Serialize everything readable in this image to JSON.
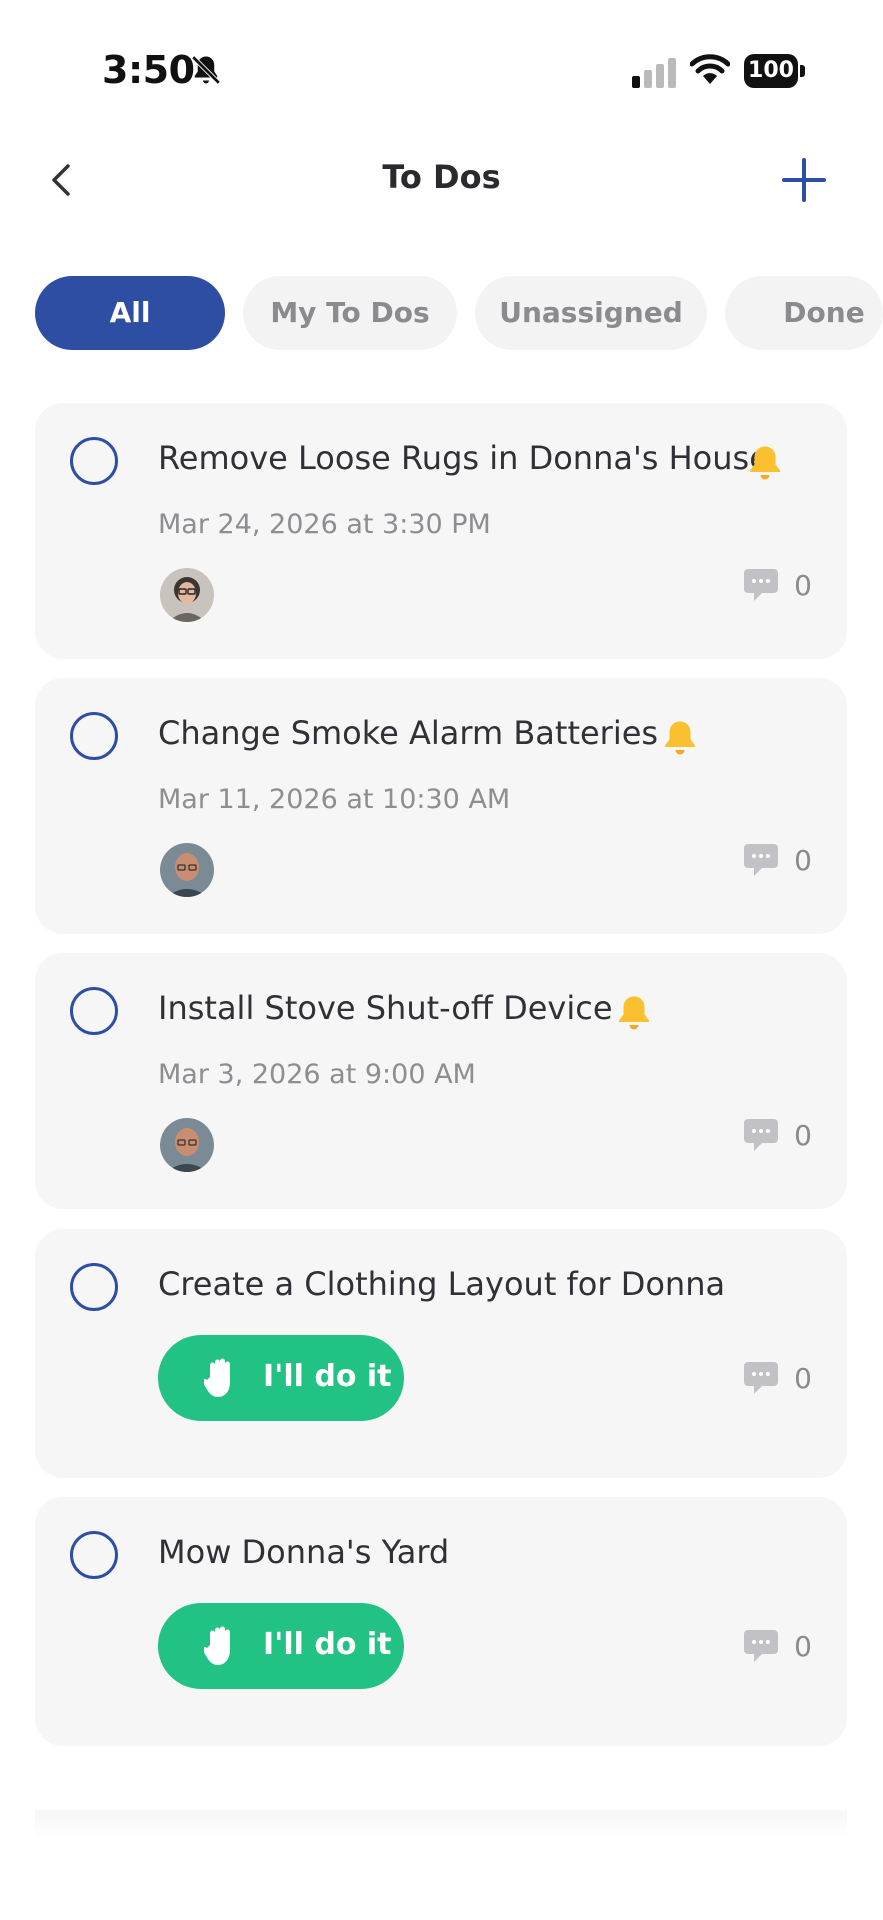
{
  "status_bar": {
    "time": "3:50",
    "battery": "100"
  },
  "header": {
    "title": "To Dos"
  },
  "tabs": [
    {
      "label": "All",
      "active": true
    },
    {
      "label": "My To Dos",
      "active": false
    },
    {
      "label": "Unassigned",
      "active": false
    },
    {
      "label": "Done",
      "active": false
    }
  ],
  "todos": [
    {
      "title": "Remove Loose Rugs in Donna's House",
      "date": "Mar 24, 2026 at 3:30 PM",
      "reminder": true,
      "assignee_icon": "woman-avatar",
      "comments": "0"
    },
    {
      "title": "Change Smoke Alarm Batteries",
      "date": "Mar 11, 2026 at 10:30 AM",
      "reminder": true,
      "assignee_icon": "man-avatar",
      "comments": "0"
    },
    {
      "title": "Install Stove Shut-off Device",
      "date": "Mar 3, 2026 at 9:00 AM",
      "reminder": true,
      "assignee_icon": "man-avatar",
      "comments": "0"
    },
    {
      "title": "Create a Clothing Layout for Donna",
      "action_label": "I'll do it",
      "comments": "0"
    },
    {
      "title": "Mow Donna's Yard",
      "action_label": "I'll do it",
      "comments": "0"
    }
  ],
  "colors": {
    "accent": "#2d4ea3",
    "action": "#22c284",
    "bell": "#fbc02d",
    "card": "#f6f6f6"
  },
  "icons": {
    "reminder": "bell-icon",
    "comment": "comment-icon",
    "action": "hand-icon"
  }
}
